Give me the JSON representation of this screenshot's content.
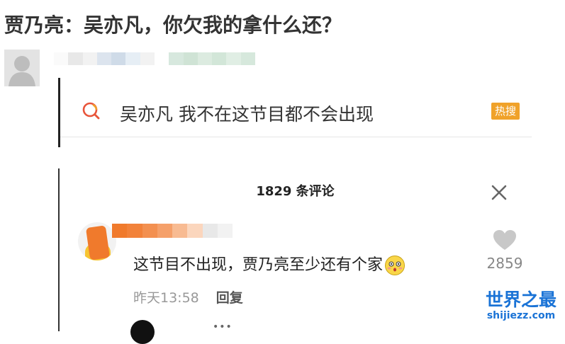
{
  "article": {
    "title": "贾乃亮：吴亦凡，你欠我的拿什么还？"
  },
  "hot_search": {
    "query": "吴亦凡 我不在这节目都不会出现",
    "badge": "热搜"
  },
  "comments": {
    "header": "1829 条评论",
    "items": [
      {
        "text": "这节目不出现，贾乃亮至少还有个家",
        "time": "昨天13:58",
        "reply_label": "回复",
        "likes": "2859"
      }
    ]
  },
  "next_comment": {
    "dots": "•••"
  },
  "watermark": {
    "logo": "世界之最",
    "url": "shijiezz.com"
  },
  "colors": {
    "badge": "#f0a22a",
    "watermark": "#1a73d6",
    "name_redaction": "#f07a2c"
  }
}
